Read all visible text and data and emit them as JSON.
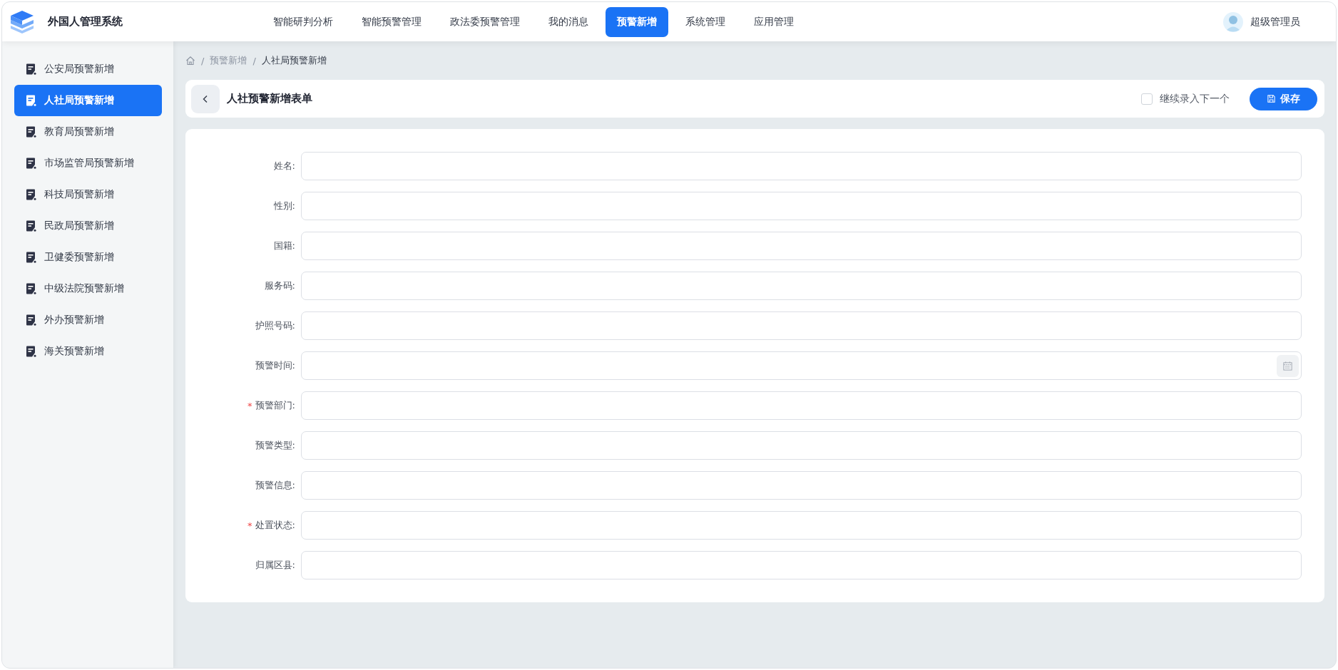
{
  "app": {
    "title": "外国人管理系统"
  },
  "nav": [
    {
      "label": "智能研判分析",
      "selected": false
    },
    {
      "label": "智能预警管理",
      "selected": false
    },
    {
      "label": "政法委预警管理",
      "selected": false
    },
    {
      "label": "我的消息",
      "selected": false
    },
    {
      "label": "预警新增",
      "selected": true
    },
    {
      "label": "系统管理",
      "selected": false
    },
    {
      "label": "应用管理",
      "selected": false
    }
  ],
  "user": {
    "name": "超级管理员"
  },
  "sidebar": {
    "items": [
      {
        "label": "公安局预警新增",
        "selected": false
      },
      {
        "label": "人社局预警新增",
        "selected": true
      },
      {
        "label": "教育局预警新增",
        "selected": false
      },
      {
        "label": "市场监管局预警新增",
        "selected": false
      },
      {
        "label": "科技局预警新增",
        "selected": false
      },
      {
        "label": "民政局预警新增",
        "selected": false
      },
      {
        "label": "卫健委预警新增",
        "selected": false
      },
      {
        "label": "中级法院预警新增",
        "selected": false
      },
      {
        "label": "外办预警新增",
        "selected": false
      },
      {
        "label": "海关预警新增",
        "selected": false
      }
    ]
  },
  "breadcrumb": [
    {
      "separator": "/",
      "label": "预警新增"
    },
    {
      "separator": "/",
      "label": "人社局预警新增"
    }
  ],
  "form_header": {
    "title": "人社预警新增表单",
    "continue_label": "继续录入下一个",
    "continue_checked": false,
    "save": "保存"
  },
  "fields": [
    {
      "label": "姓名:",
      "kind": "text"
    },
    {
      "label": "性别:",
      "kind": "text"
    },
    {
      "label": "国籍:",
      "kind": "text"
    },
    {
      "label": "服务码:",
      "kind": "text"
    },
    {
      "label": "护照号码:",
      "kind": "text"
    },
    {
      "label": "预警时间:",
      "kind": "date"
    },
    {
      "label": "预警部门:",
      "kind": "text",
      "required_mark": "*"
    },
    {
      "label": "预警类型:",
      "kind": "text"
    },
    {
      "label": "预警信息:",
      "kind": "text"
    },
    {
      "label": "处置状态:",
      "kind": "text",
      "required_mark": "*"
    },
    {
      "label": "归属区县:",
      "kind": "text"
    }
  ]
}
